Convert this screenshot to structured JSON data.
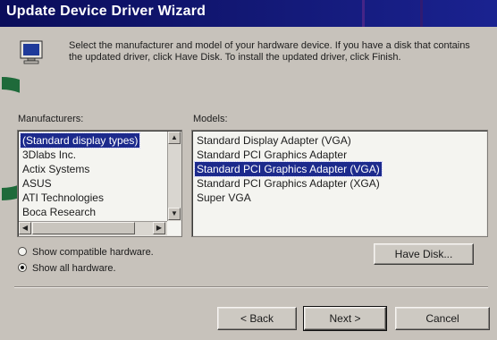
{
  "window": {
    "title": "Update Device Driver Wizard"
  },
  "intro": {
    "icon": "monitor-icon",
    "text": "Select the manufacturer and model of your hardware device. If you have a disk that contains the updated driver, click Have Disk. To install the updated driver, click Finish."
  },
  "manufacturers": {
    "label": "Manufacturers:",
    "items": [
      "(Standard display types)",
      "3Dlabs Inc.",
      "Actix Systems",
      "ASUS",
      "ATI Technologies",
      "Boca Research"
    ],
    "selected_index": 0
  },
  "models": {
    "label": "Models:",
    "items": [
      "Standard Display Adapter (VGA)",
      "Standard PCI Graphics Adapter",
      "Standard PCI Graphics Adapter (VGA)",
      "Standard PCI Graphics Adapter (XGA)",
      "Super VGA"
    ],
    "selected_index": 2
  },
  "options": {
    "compatible_label": "Show compatible hardware.",
    "all_label": "Show all hardware.",
    "selected": "all"
  },
  "buttons": {
    "have_disk": "Have Disk...",
    "back": "< Back",
    "next": "Next >",
    "cancel": "Cancel"
  },
  "colors": {
    "title_bar": "#0a0d5a",
    "selection": "#1c2a8c",
    "dialog_bg": "#c7c2bb"
  }
}
